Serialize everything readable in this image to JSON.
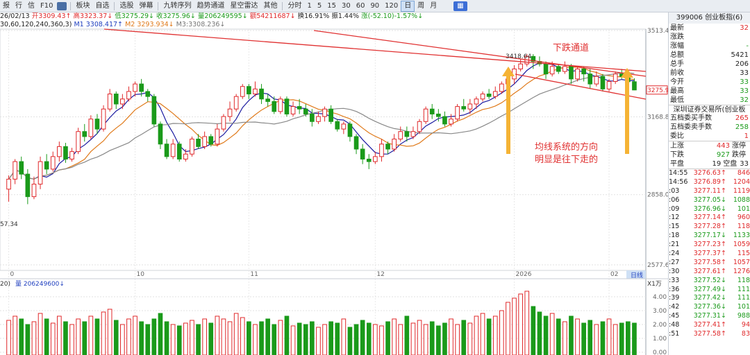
{
  "toolbar": {
    "items": [
      "报",
      "行",
      "信",
      "F10",
      "",
      "板块",
      "自选",
      "选股",
      "弹幕",
      "九转序列",
      "趋势通道",
      "星空雷达",
      "其他"
    ],
    "periods": [
      "分时",
      "1",
      "5",
      "15",
      "30",
      "60",
      "90",
      "120",
      "日",
      "周",
      "月"
    ],
    "selected_period": "日"
  },
  "ohlc": {
    "date": "26/02/13",
    "open": "开3309.43↑",
    "high": "高3323.37↓",
    "low": "低3275.29↓",
    "close": "收3275.96↓",
    "volume": "量206249595↓",
    "amount": "额54211687↓",
    "turnover": "换16.91%",
    "amplitude": "振1.44%",
    "change": "涨(-52.10)-1.57%↓"
  },
  "ma": {
    "params": "30,60,120,240,360,3)",
    "m1": "M1 3308.417↑",
    "m2": "M2 3293.934↓",
    "m3": "M3:3308.236↓",
    "colors": {
      "m1": "#1a1aa0",
      "m2": "#e07a1a",
      "m3": "#888888"
    }
  },
  "price_axis": {
    "ticks": [
      "3513.47",
      "3168.83",
      "2858.00",
      "2577.65"
    ],
    "current": "3275.96",
    "low_label": "57.34",
    "peak_label": "3418.64"
  },
  "date_axis": {
    "labels": [
      "0",
      "10",
      "11",
      "12",
      "2026",
      "02"
    ],
    "badge": "日线"
  },
  "volume_panel": {
    "label": "20)",
    "vol_label": "量 206249600↓",
    "unit": "X1万",
    "ticks": [
      "4.00",
      "3.00",
      "2.00",
      "1.00",
      "0.00"
    ]
  },
  "annotations": {
    "channel_title": "下跌通道",
    "ma_note_line1": "均线系统的方向",
    "ma_note_line2": "明显是往下走的"
  },
  "quote_panel": {
    "header": "399006 创业板指(6)",
    "fields": [
      {
        "label": "最新",
        "value": "32",
        "color": "red"
      },
      {
        "label": "涨跌",
        "value": "",
        "color": "green"
      },
      {
        "label": "涨幅",
        "value": "-",
        "color": "green"
      },
      {
        "label": "总额",
        "value": "5421",
        "color": "blk"
      },
      {
        "label": "总手",
        "value": "206",
        "color": "blk"
      },
      {
        "label": "前收",
        "value": "33",
        "color": "blk"
      },
      {
        "label": "今开",
        "value": "33",
        "color": "green"
      },
      {
        "label": "最高",
        "value": "33",
        "color": "green"
      },
      {
        "label": "最低",
        "value": "32",
        "color": "green"
      }
    ],
    "exchange": "深圳证券交易所(创业板",
    "depth": [
      {
        "label": "五档委买手数",
        "value": "265",
        "color": "red"
      },
      {
        "label": "五档委卖手数",
        "value": "258",
        "color": "green"
      },
      {
        "label": "委比",
        "value": "1",
        "color": "red"
      }
    ],
    "breadth": [
      {
        "label": "上涨",
        "num": "443",
        "num_color": "red",
        "label2": "涨停"
      },
      {
        "label": "下跌",
        "num": "927",
        "num_color": "green",
        "label2": "跌停"
      },
      {
        "label": "平盘",
        "num": "19",
        "num_color": "blk",
        "label2": "空盘",
        "extra": "33"
      }
    ],
    "ticks": [
      {
        "time": "14:55",
        "price": "3276.63↑",
        "vol": "846"
      },
      {
        "time": "14:56",
        "price": "3276.89↑",
        "vol": "1204"
      },
      {
        "time": ":03",
        "price": "3277.11↑",
        "vol": "1119"
      },
      {
        "time": ":06",
        "price": "3277.05↓",
        "vol": "1088"
      },
      {
        "time": ":09",
        "price": "3276.96↓",
        "vol": "101"
      },
      {
        "time": ":12",
        "price": "3277.14↑",
        "vol": "960"
      },
      {
        "time": ":15",
        "price": "3277.28↑",
        "vol": "118"
      },
      {
        "time": ":18",
        "price": "3277.17↓",
        "vol": "1133"
      },
      {
        "time": ":21",
        "price": "3277.23↑",
        "vol": "1059"
      },
      {
        "time": ":24",
        "price": "3277.37↑",
        "vol": "115"
      },
      {
        "time": ":27",
        "price": "3277.58↑",
        "vol": "1057"
      },
      {
        "time": ":30",
        "price": "3277.61↑",
        "vol": "1276"
      },
      {
        "time": ":33",
        "price": "3277.52↓",
        "vol": "118"
      },
      {
        "time": ":36",
        "price": "3277.49↓",
        "vol": "111"
      },
      {
        "time": ":39",
        "price": "3277.42↓",
        "vol": "111"
      },
      {
        "time": ":42",
        "price": "3277.36↓",
        "vol": "101"
      },
      {
        "time": ":45",
        "price": "3277.31↓",
        "vol": "988"
      },
      {
        "time": ":48",
        "price": "3277.41↑",
        "vol": "94"
      },
      {
        "time": ":51",
        "price": "3277.58↑",
        "vol": "83"
      }
    ]
  },
  "colors": {
    "up": "#e0282a",
    "down": "#1a9a1a",
    "channel": "#e03030",
    "arrow": "#f5b335"
  },
  "chart_data": {
    "type": "candlestick",
    "y_range": [
      2577.65,
      3513.47
    ],
    "candles": [
      [
        2880,
        2920,
        2830,
        2935
      ],
      [
        2920,
        2990,
        2900,
        3000
      ],
      [
        2990,
        2940,
        2920,
        3010
      ],
      [
        2940,
        2850,
        2820,
        2960
      ],
      [
        2850,
        2900,
        2840,
        2930
      ],
      [
        2900,
        2990,
        2880,
        3010
      ],
      [
        2990,
        2960,
        2940,
        3020
      ],
      [
        2960,
        3010,
        2950,
        3030
      ],
      [
        3010,
        3050,
        2990,
        3070
      ],
      [
        3050,
        3000,
        2985,
        3065
      ],
      [
        3000,
        3030,
        2990,
        3045
      ],
      [
        3030,
        3110,
        3020,
        3125
      ],
      [
        3110,
        3090,
        3070,
        3140
      ],
      [
        3090,
        3160,
        3080,
        3175
      ],
      [
        3160,
        3120,
        3100,
        3180
      ],
      [
        3120,
        3200,
        3110,
        3215
      ],
      [
        3200,
        3260,
        3190,
        3280
      ],
      [
        3260,
        3220,
        3200,
        3270
      ],
      [
        3220,
        3240,
        3200,
        3260
      ],
      [
        3240,
        3270,
        3230,
        3290
      ],
      [
        3270,
        3300,
        3250,
        3310
      ],
      [
        3300,
        3270,
        3250,
        3320
      ],
      [
        3270,
        3250,
        3230,
        3280
      ],
      [
        3250,
        3140,
        3130,
        3260
      ],
      [
        3140,
        3060,
        3040,
        3150
      ],
      [
        3060,
        3010,
        3000,
        3080
      ],
      [
        3010,
        3060,
        3000,
        3080
      ],
      [
        3060,
        3000,
        2990,
        3070
      ],
      [
        3000,
        3020,
        2990,
        3040
      ],
      [
        3020,
        3080,
        3010,
        3090
      ],
      [
        3080,
        3050,
        3040,
        3100
      ],
      [
        3050,
        3090,
        3040,
        3110
      ],
      [
        3090,
        3060,
        3050,
        3100
      ],
      [
        3060,
        3120,
        3050,
        3140
      ],
      [
        3120,
        3170,
        3110,
        3180
      ],
      [
        3170,
        3200,
        3150,
        3230
      ],
      [
        3200,
        3250,
        3190,
        3260
      ],
      [
        3250,
        3290,
        3240,
        3300
      ],
      [
        3290,
        3260,
        3240,
        3300
      ],
      [
        3260,
        3280,
        3250,
        3310
      ],
      [
        3280,
        3240,
        3220,
        3300
      ],
      [
        3240,
        3230,
        3210,
        3260
      ],
      [
        3230,
        3190,
        3180,
        3250
      ],
      [
        3190,
        3240,
        3180,
        3250
      ],
      [
        3240,
        3180,
        3170,
        3250
      ],
      [
        3180,
        3210,
        3170,
        3230
      ],
      [
        3210,
        3200,
        3180,
        3240
      ],
      [
        3200,
        3180,
        3170,
        3220
      ],
      [
        3180,
        3150,
        3130,
        3200
      ],
      [
        3150,
        3170,
        3140,
        3190
      ],
      [
        3170,
        3200,
        3150,
        3210
      ],
      [
        3200,
        3150,
        3140,
        3215
      ],
      [
        3150,
        3120,
        3110,
        3160
      ],
      [
        3120,
        3140,
        3100,
        3150
      ],
      [
        3140,
        3090,
        3070,
        3150
      ],
      [
        3090,
        3040,
        3020,
        3100
      ],
      [
        3040,
        3000,
        2980,
        3060
      ],
      [
        3000,
        2990,
        2960,
        3020
      ],
      [
        2990,
        3010,
        2980,
        3030
      ],
      [
        3010,
        3060,
        2990,
        3080
      ],
      [
        3060,
        3040,
        3020,
        3070
      ],
      [
        3040,
        3080,
        3030,
        3100
      ],
      [
        3080,
        3110,
        3070,
        3130
      ],
      [
        3110,
        3090,
        3070,
        3130
      ],
      [
        3090,
        3110,
        3080,
        3130
      ],
      [
        3110,
        3150,
        3100,
        3160
      ],
      [
        3150,
        3200,
        3140,
        3210
      ],
      [
        3200,
        3180,
        3160,
        3220
      ],
      [
        3180,
        3170,
        3150,
        3200
      ],
      [
        3170,
        3140,
        3130,
        3190
      ],
      [
        3140,
        3160,
        3130,
        3180
      ],
      [
        3160,
        3210,
        3150,
        3220
      ],
      [
        3210,
        3200,
        3190,
        3240
      ],
      [
        3200,
        3220,
        3180,
        3240
      ],
      [
        3220,
        3240,
        3200,
        3250
      ],
      [
        3240,
        3260,
        3230,
        3270
      ],
      [
        3260,
        3250,
        3240,
        3280
      ],
      [
        3250,
        3270,
        3240,
        3290
      ],
      [
        3270,
        3300,
        3260,
        3310
      ],
      [
        3300,
        3320,
        3290,
        3340
      ],
      [
        3320,
        3360,
        3300,
        3375
      ],
      [
        3360,
        3380,
        3350,
        3400
      ],
      [
        3380,
        3410,
        3370,
        3419
      ],
      [
        3410,
        3390,
        3360,
        3419
      ],
      [
        3390,
        3380,
        3370,
        3410
      ],
      [
        3380,
        3340,
        3320,
        3390
      ],
      [
        3340,
        3370,
        3330,
        3390
      ],
      [
        3370,
        3350,
        3340,
        3380
      ],
      [
        3350,
        3370,
        3340,
        3390
      ],
      [
        3370,
        3320,
        3300,
        3380
      ],
      [
        3320,
        3360,
        3310,
        3370
      ],
      [
        3360,
        3340,
        3310,
        3370
      ],
      [
        3340,
        3300,
        3280,
        3360
      ],
      [
        3300,
        3330,
        3290,
        3350
      ],
      [
        3330,
        3280,
        3270,
        3340
      ],
      [
        3280,
        3310,
        3270,
        3320
      ],
      [
        3310,
        3340,
        3300,
        3350
      ],
      [
        3340,
        3330,
        3320,
        3360
      ],
      [
        3330,
        3309,
        3290,
        3340
      ],
      [
        3309,
        3276,
        3275,
        3323
      ]
    ],
    "volumes": [
      2.3,
      2.6,
      2.4,
      2.0,
      2.2,
      2.8,
      2.4,
      2.1,
      2.6,
      2.2,
      2.0,
      2.4,
      2.2,
      2.6,
      2.4,
      2.9,
      3.1,
      2.3,
      2.0,
      2.4,
      2.6,
      2.2,
      2.0,
      2.4,
      2.8,
      2.2,
      2.0,
      1.9,
      2.1,
      2.3,
      2.0,
      2.4,
      2.1,
      2.6,
      2.4,
      2.2,
      2.8,
      2.5,
      2.2,
      2.0,
      2.2,
      2.4,
      2.0,
      2.3,
      2.6,
      1.9,
      2.1,
      2.0,
      2.2,
      1.8,
      2.0,
      2.2,
      2.1,
      2.4,
      1.8,
      2.0,
      2.3,
      2.1,
      2.0,
      1.9,
      2.2,
      2.4,
      2.0,
      2.6,
      2.1,
      2.3,
      2.0,
      2.2,
      1.9,
      2.1,
      2.4,
      2.0,
      2.3,
      2.1,
      2.6,
      2.8,
      2.4,
      2.6,
      3.0,
      3.6,
      3.9,
      4.2,
      4.4,
      3.3,
      2.9,
      2.6,
      2.8,
      2.4,
      2.2,
      2.6,
      2.4,
      2.1,
      2.3,
      2.0,
      2.2,
      2.4,
      2.0,
      2.1,
      2.2,
      2.1
    ]
  }
}
